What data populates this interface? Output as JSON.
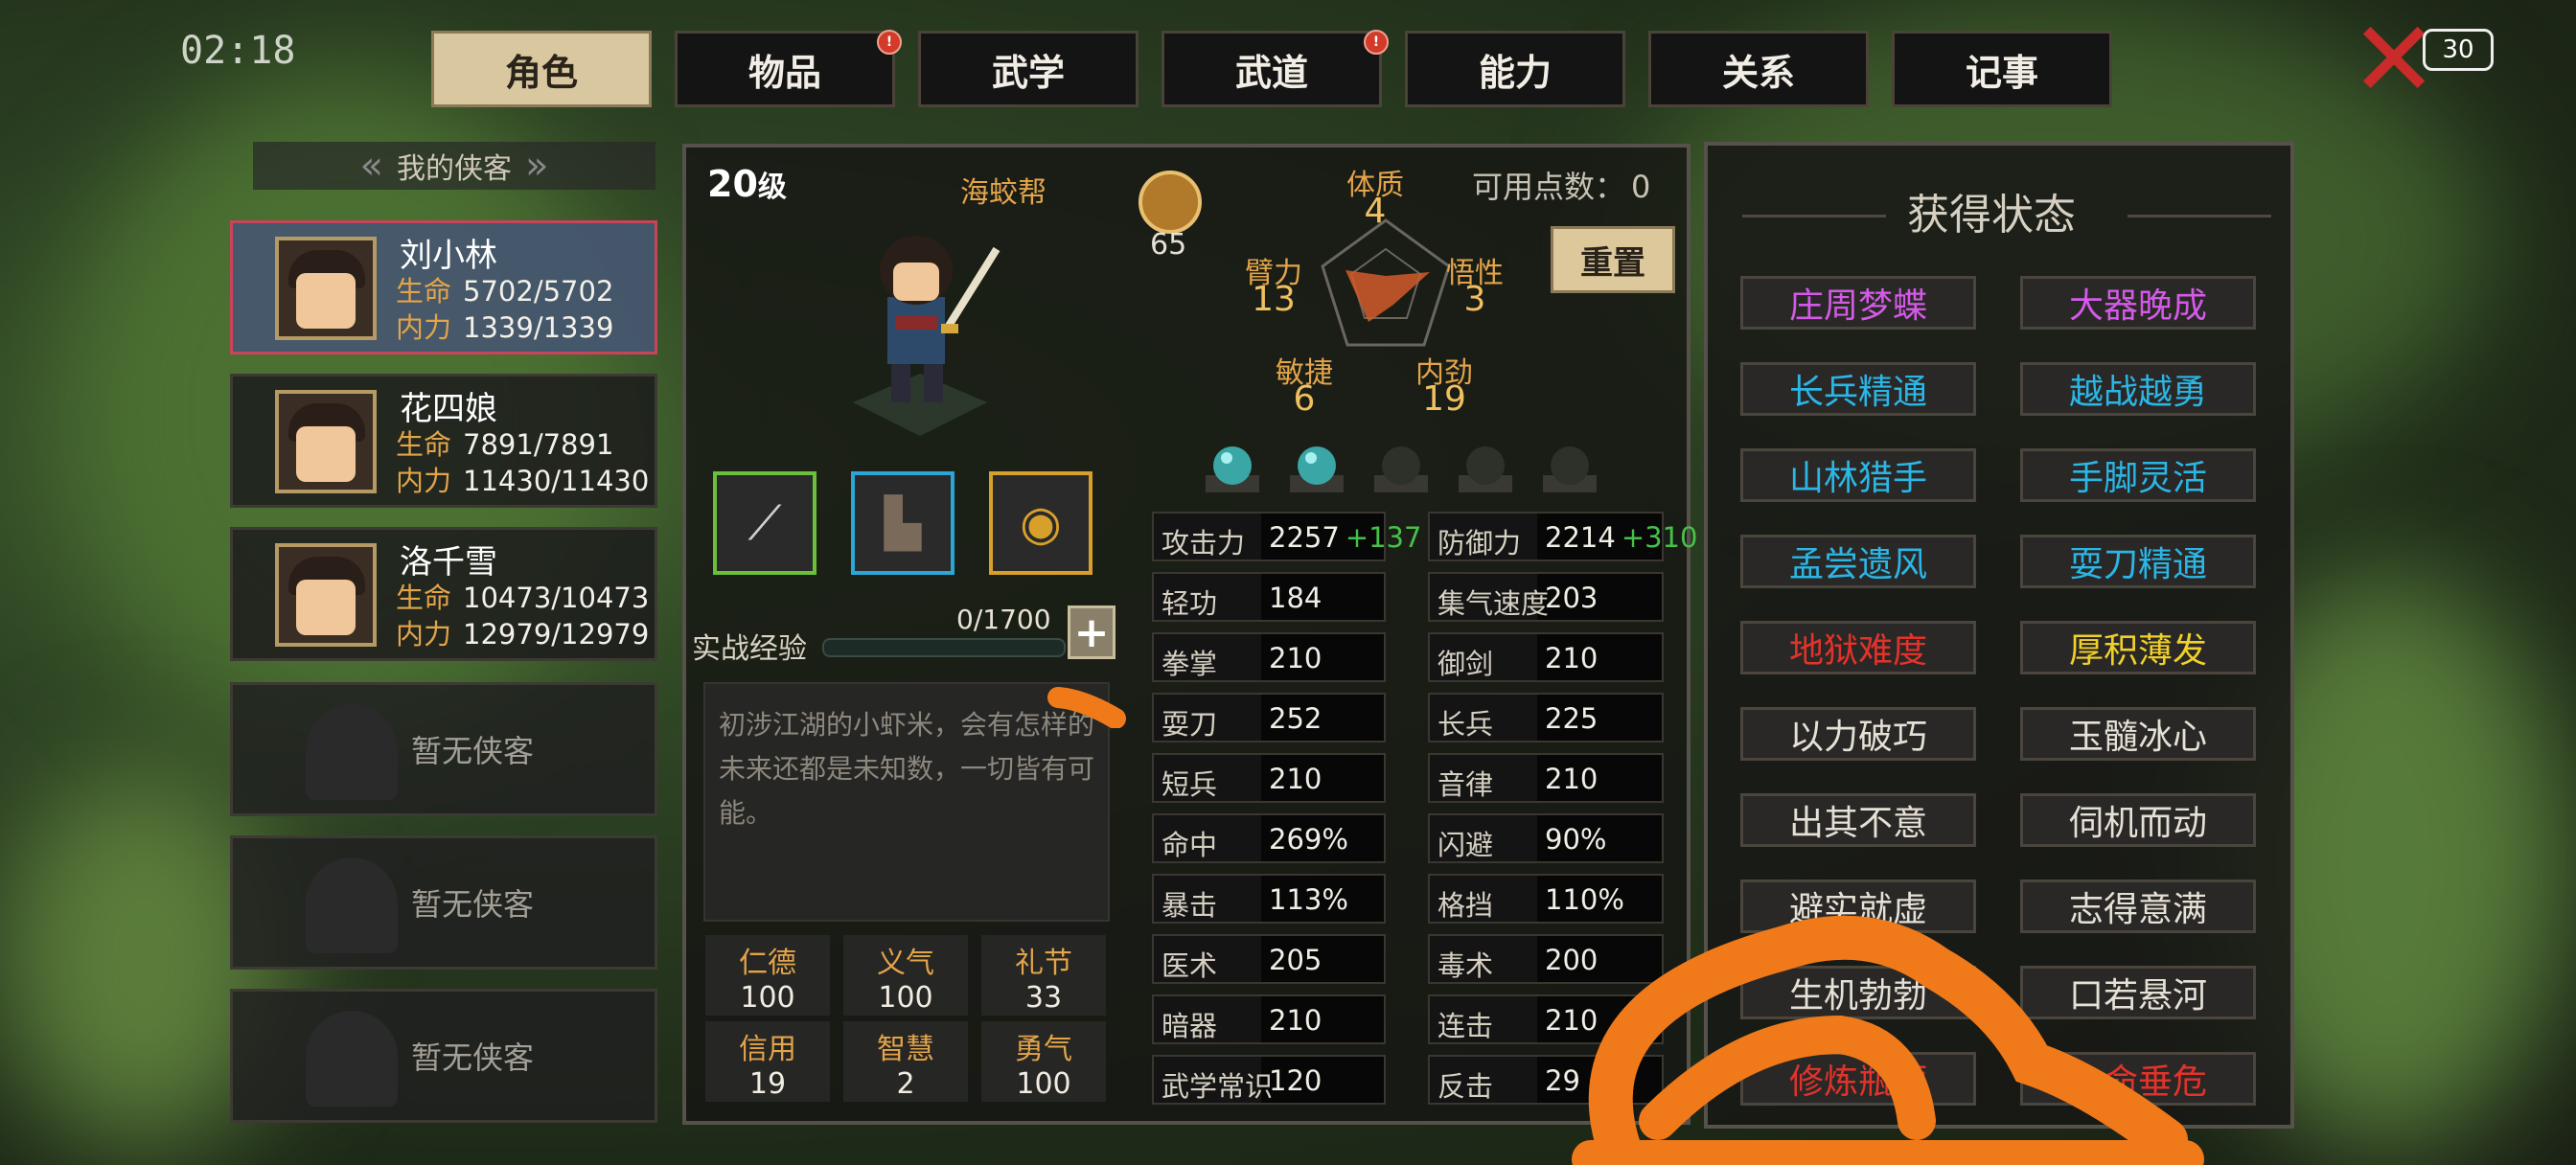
{
  "status": {
    "time": "02:18",
    "battery": "30"
  },
  "tabs": [
    {
      "label": "角色",
      "active": true,
      "badge": false
    },
    {
      "label": "物品",
      "active": false,
      "badge": true
    },
    {
      "label": "武学",
      "active": false,
      "badge": false
    },
    {
      "label": "武道",
      "active": false,
      "badge": true
    },
    {
      "label": "能力",
      "active": false,
      "badge": false
    },
    {
      "label": "关系",
      "active": false,
      "badge": false
    },
    {
      "label": "记事",
      "active": false,
      "badge": false
    }
  ],
  "roster": {
    "header": "我的侠客",
    "chars": [
      {
        "name": "刘小林",
        "hp_label": "生命",
        "hp": "5702/5702",
        "mp_label": "内力",
        "mp": "1339/1339"
      },
      {
        "name": "花四娘",
        "hp_label": "生命",
        "hp": "7891/7891",
        "mp_label": "内力",
        "mp": "11430/11430"
      },
      {
        "name": "洛千雪",
        "hp_label": "生命",
        "hp": "10473/10473",
        "mp_label": "内力",
        "mp": "12979/12979"
      }
    ],
    "empty_label": "暂无侠客"
  },
  "profile": {
    "level": "20",
    "level_unit": "级",
    "sect": "海蛟帮",
    "emblem_value": "65",
    "exp_label": "实战经验",
    "exp_value": "0/1700",
    "exp_fraction": 0,
    "description": "初涉江湖的小虾米，会有怎样的未来还都是未知数，一切皆有可能。",
    "virtues": [
      {
        "label": "仁德",
        "value": "100"
      },
      {
        "label": "义气",
        "value": "100"
      },
      {
        "label": "礼节",
        "value": "33"
      },
      {
        "label": "信用",
        "value": "19"
      },
      {
        "label": "智慧",
        "value": "2"
      },
      {
        "label": "勇气",
        "value": "100"
      }
    ]
  },
  "attributes": {
    "available_points_label": "可用点数：",
    "available_points": "0",
    "reset_label": "重置",
    "stats": [
      {
        "label": "体质",
        "value": "4"
      },
      {
        "label": "臂力",
        "value": "13"
      },
      {
        "label": "悟性",
        "value": "3"
      },
      {
        "label": "敏捷",
        "value": "6"
      },
      {
        "label": "内劲",
        "value": "19"
      }
    ]
  },
  "combat_stats": [
    {
      "label": "攻击力",
      "value": "2257",
      "bonus": "+137"
    },
    {
      "label": "防御力",
      "value": "2214",
      "bonus": "+310"
    },
    {
      "label": "轻功",
      "value": "184",
      "bonus": ""
    },
    {
      "label": "集气速度",
      "value": "203",
      "bonus": ""
    },
    {
      "label": "拳掌",
      "value": "210",
      "bonus": ""
    },
    {
      "label": "御剑",
      "value": "210",
      "bonus": ""
    },
    {
      "label": "耍刀",
      "value": "252",
      "bonus": ""
    },
    {
      "label": "长兵",
      "value": "225",
      "bonus": ""
    },
    {
      "label": "短兵",
      "value": "210",
      "bonus": ""
    },
    {
      "label": "音律",
      "value": "210",
      "bonus": ""
    },
    {
      "label": "命中",
      "value": "269%",
      "bonus": ""
    },
    {
      "label": "闪避",
      "value": "90%",
      "bonus": ""
    },
    {
      "label": "暴击",
      "value": "113%",
      "bonus": ""
    },
    {
      "label": "格挡",
      "value": "110%",
      "bonus": ""
    },
    {
      "label": "医术",
      "value": "205",
      "bonus": ""
    },
    {
      "label": "毒术",
      "value": "200",
      "bonus": ""
    },
    {
      "label": "暗器",
      "value": "210",
      "bonus": ""
    },
    {
      "label": "连击",
      "value": "210",
      "bonus": ""
    },
    {
      "label": "武学常识",
      "value": "120",
      "bonus": ""
    },
    {
      "label": "反击",
      "value": "29",
      "bonus": ""
    }
  ],
  "status_panel": {
    "title": "获得状态",
    "buffs": [
      {
        "label": "庄周梦蝶",
        "color": "#d35ae8"
      },
      {
        "label": "大器晚成",
        "color": "#d35ae8"
      },
      {
        "label": "长兵精通",
        "color": "#2bb6e6"
      },
      {
        "label": "越战越勇",
        "color": "#2bb6e6"
      },
      {
        "label": "山林猎手",
        "color": "#2bb6e6"
      },
      {
        "label": "手脚灵活",
        "color": "#2bb6e6"
      },
      {
        "label": "孟尝遗风",
        "color": "#2bb6e6"
      },
      {
        "label": "耍刀精通",
        "color": "#2bb6e6"
      },
      {
        "label": "地狱难度",
        "color": "#e2332b"
      },
      {
        "label": "厚积薄发",
        "color": "#f0d12a"
      },
      {
        "label": "以力破巧",
        "color": "#e6e1d6"
      },
      {
        "label": "玉髓冰心",
        "color": "#e6e1d6"
      },
      {
        "label": "出其不意",
        "color": "#e6e1d6"
      },
      {
        "label": "伺机而动",
        "color": "#e6e1d6"
      },
      {
        "label": "避实就虚",
        "color": "#e6e1d6"
      },
      {
        "label": "志得意满",
        "color": "#e6e1d6"
      },
      {
        "label": "生机勃勃",
        "color": "#e6e1d6"
      },
      {
        "label": "口若悬河",
        "color": "#e6e1d6"
      },
      {
        "label": "修炼瓶颈",
        "color": "#e2332b"
      },
      {
        "label": "生命垂危",
        "color": "#e2332b"
      }
    ]
  }
}
